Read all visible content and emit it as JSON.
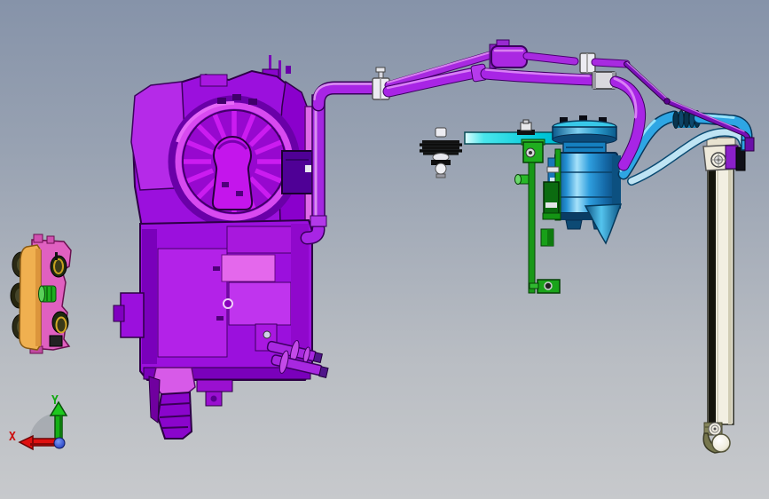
{
  "viewport": {
    "background_top": "#8693a9",
    "background_bottom": "#c7c9cc"
  },
  "triad": {
    "x_label": "X",
    "y_label": "Y",
    "x_color": "#e01010",
    "y_color": "#14b014",
    "origin_color": "#2a50e8"
  },
  "palette": {
    "hvac_purple": "#9b10dd",
    "hvac_magenta": "#c415ec",
    "hvac_pink": "#e468ec",
    "hvac_violet": "#b322e8",
    "hvac_deep": "#7a00bb",
    "hose_purple": "#a825e5",
    "hose_thin_purple": "#7a10b8",
    "hose_cyan": "#2ea6e4",
    "hose_cyan_light": "#bfe4f4",
    "compressor_blue": "#1e90d8",
    "bar_cyan": "#00c8d8",
    "bracket_green": "#1fae1f",
    "bracket_dark_green": "#0b6b10",
    "control_orange": "#f0b050",
    "control_pink": "#e060c0",
    "drier_cream": "#f2efe2",
    "drier_olive": "#85855c",
    "clamp_white": "#ececf2"
  }
}
